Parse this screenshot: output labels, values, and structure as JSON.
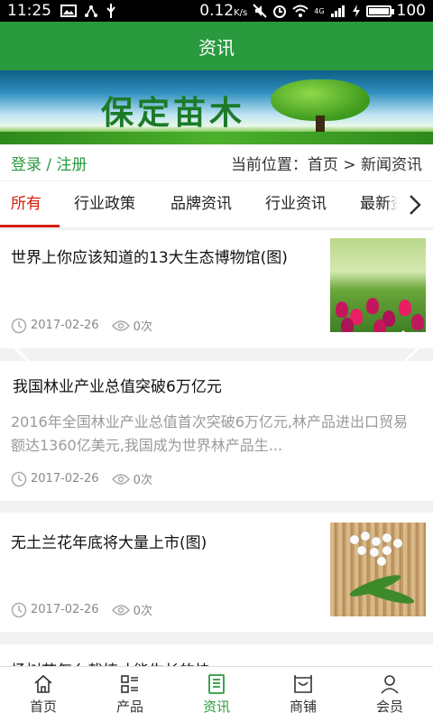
{
  "status_bar": {
    "time": "11:25",
    "speed": "0.12",
    "speed_unit": "K/s",
    "network": "4G",
    "battery": "100",
    "battery_level": 1.0
  },
  "header": {
    "title": "资讯"
  },
  "banner": {
    "text": "保定苗木"
  },
  "infobar": {
    "login": "登录",
    "separator": " / ",
    "register": "注册",
    "breadcrumb": "当前位置：首页 > 新闻资讯"
  },
  "tabs": [
    {
      "label": "所有",
      "active": true
    },
    {
      "label": "行业政策"
    },
    {
      "label": "品牌资讯"
    },
    {
      "label": "行业资讯"
    },
    {
      "label": "最新资讯"
    }
  ],
  "articles": [
    {
      "title": "世界上你应该知道的13大生态博物馆(图)",
      "date": "2017-02-26",
      "views": "0次",
      "thumb": "tulips"
    },
    {
      "title": "我国林业产业总值突破6万亿元",
      "summary": "2016年全国林业产业总值首次突破6万亿元,林产品进出口贸易额达1360亿美元,我国成为世界林产品生...",
      "date": "2017-02-26",
      "views": "0次"
    },
    {
      "title": "无土兰花年底将大量上市(图)",
      "date": "2017-02-26",
      "views": "0次",
      "thumb": "orchid"
    },
    {
      "title": "杨树苗怎么栽植才能生长的快"
    }
  ],
  "bottom_nav": [
    {
      "label": "首页",
      "icon": "home-icon"
    },
    {
      "label": "产品",
      "icon": "grid-list-icon"
    },
    {
      "label": "资讯",
      "icon": "news-icon",
      "active": true
    },
    {
      "label": "商铺",
      "icon": "shop-icon"
    },
    {
      "label": "会员",
      "icon": "user-icon"
    }
  ],
  "colors": {
    "brand_green": "#2a9a3f",
    "active_tab_red": "#d81e06"
  }
}
